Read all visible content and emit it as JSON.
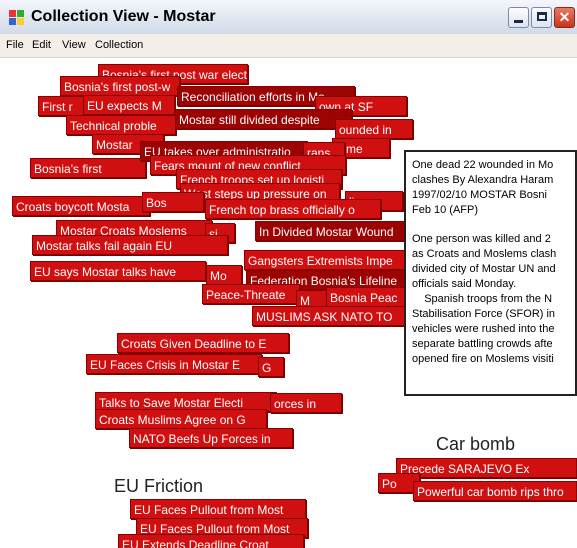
{
  "window": {
    "title": "Collection View - Mostar",
    "minimize_glyph": "",
    "maximize_glyph": "",
    "close_glyph": "✕"
  },
  "menu": [
    "File",
    "Edit",
    "View",
    "Collection"
  ],
  "tags": [
    "Bosnia's first post war elect",
    "Bosnia's first post-w",
    "Reconciliation efforts in Mo",
    "First r",
    "EU expects M",
    "own at SF",
    "Technical proble",
    "Mostar still divided despite",
    "ounded in",
    "Mostar",
    "mme",
    "Bosnia's first",
    "EU takes over administratio",
    "rans",
    "Fears mount of new conflict",
    "French troops set up logisti",
    "West steps up pressure on",
    "Croats boycott Mosta",
    "Bos",
    "lies",
    "French top brass officially o",
    "Mostar Croats Moslems",
    "si",
    "In Divided Mostar Wound",
    "Mostar talks fail again  EU",
    "Gangsters  Extremists Impe",
    "EU says Mostar talks have",
    "Mo",
    "Federation  Bosnia's Lifeline",
    "Peace-Threate",
    "M",
    "Bosnia Peac",
    "MUSLIMS ASK NATO TO",
    "Croats Given Deadline to  E",
    "EU Faces Crisis in Mostar E",
    "G",
    "Talks to Save Mostar  Electi",
    "orces in",
    "Croats  Muslims Agree on G",
    "NATO Beefs Up Forces in",
    "Precede SARAJEVO Ex",
    "Po",
    "Powerful car bomb rips thro",
    "EU Faces Pullout from Most",
    "EU Faces Pullout from Most",
    "EU Extends Deadline  Croat"
  ],
  "clusters": {
    "car_bomb": "Car bomb",
    "eu_friction": "EU Friction"
  },
  "document": {
    "lines": [
      "One dead  22 wounded in Mo",
      "clashes By Alexandra Haram",
      "1997/02/10  MOSTAR  Bosni",
      "Feb 10 (AFP)",
      "",
      "One person was killed and 2",
      "as Croats and Moslems clash",
      "divided city of Mostar  UN and",
      "officials said Monday.",
      "    Spanish troops from the N",
      "Stabilisation Force (SFOR) in",
      "vehicles were rushed into the",
      "separate battling crowds afte",
      "opened fire on Moslems visiti"
    ]
  }
}
